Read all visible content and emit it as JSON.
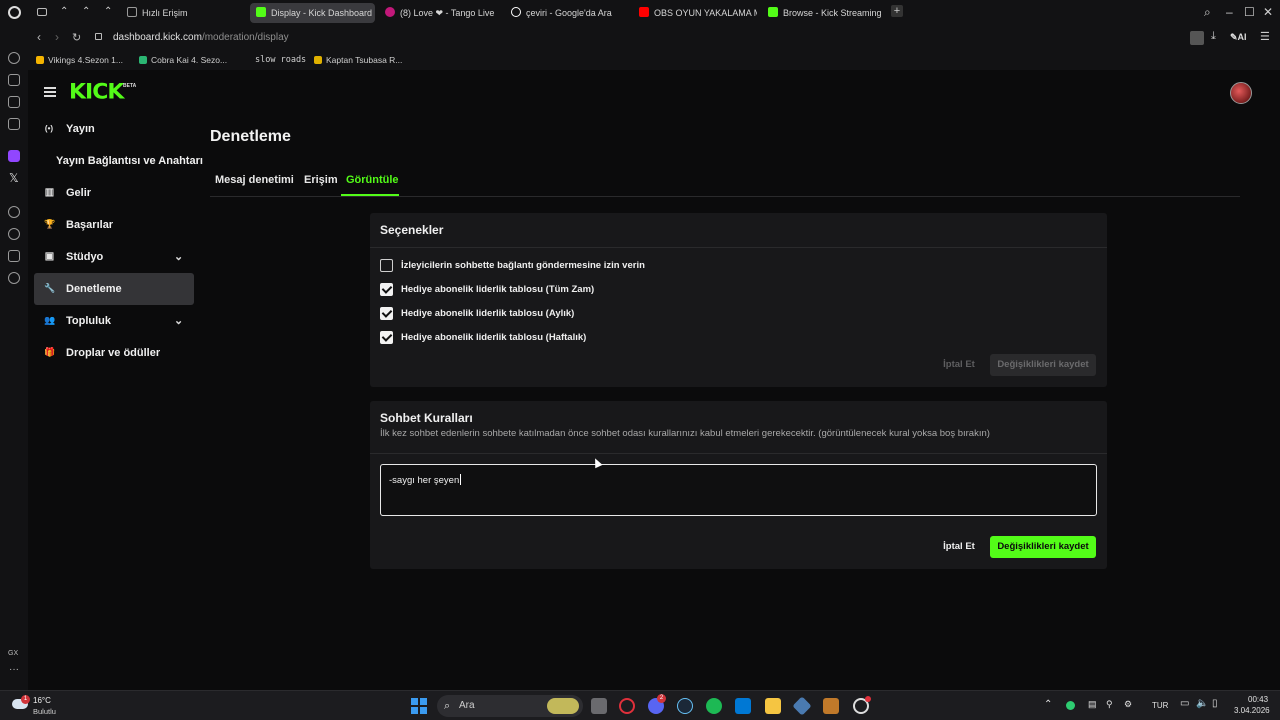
{
  "browser": {
    "tabs": [
      {
        "label": "Hızlı Erişim",
        "icon": "grid-icon",
        "color": "#9a9a9a"
      },
      {
        "label": "Display - Kick Dashboard",
        "icon": "kick-icon",
        "color": "#53fc18",
        "active": true
      },
      {
        "label": "(8) Love ❤ - Tango Live",
        "icon": "tango-icon",
        "color": "#c2187a"
      },
      {
        "label": "çeviri - Google'da Ara",
        "icon": "google-icon",
        "color": "#ffffff"
      },
      {
        "label": "OBS OYUN YAKALAMA M",
        "icon": "youtube-icon",
        "color": "#ff0000"
      },
      {
        "label": "Browse - Kick Streaming",
        "icon": "kick-icon",
        "color": "#53fc18"
      }
    ],
    "url_domain": "dashboard.kick.com",
    "url_path": "/moderation/display",
    "ai_label": "AI",
    "bookmarks": [
      {
        "label": "Vikings 4.Sezon 1...",
        "color": "#f5b400"
      },
      {
        "label": "Cobra Kai 4. Sezo...",
        "color": "#2bb673"
      },
      {
        "label": "slow roads",
        "color": ""
      },
      {
        "label": "Kaptan Tsubasa R...",
        "color": "#e0b100"
      }
    ],
    "gx_label": "GX"
  },
  "kick": {
    "logo": "KICK",
    "logo_badge": "BETA",
    "sidebar": [
      {
        "label": "Yayın",
        "icon": "broadcast-icon",
        "glyph": "(•)",
        "chevron": false,
        "active": false
      },
      {
        "label": "Yayın Bağlantısı ve Anahtarı",
        "icon": "",
        "glyph": "",
        "chevron": false,
        "active": false
      },
      {
        "label": "Gelir",
        "icon": "revenue-icon",
        "glyph": "▥",
        "chevron": false,
        "active": false
      },
      {
        "label": "Başarılar",
        "icon": "trophy-icon",
        "glyph": "🏆",
        "chevron": false,
        "active": false
      },
      {
        "label": "Stüdyo",
        "icon": "studio-icon",
        "glyph": "▣",
        "chevron": true,
        "active": false
      },
      {
        "label": "Denetleme",
        "icon": "wrench-icon",
        "glyph": "🔧",
        "chevron": false,
        "active": true
      },
      {
        "label": "Topluluk",
        "icon": "community-icon",
        "glyph": "👥",
        "chevron": true,
        "active": false
      },
      {
        "label": "Droplar ve ödüller",
        "icon": "gift-icon",
        "glyph": "🎁",
        "chevron": false,
        "active": false
      }
    ],
    "page_title": "Denetleme",
    "tabs": [
      "Mesaj denetimi",
      "Erişim",
      "Görüntüle"
    ],
    "accent": "#53fc18",
    "options_card": {
      "title": "Seçenekler",
      "options": [
        {
          "label": "İzleyicilerin sohbette bağlantı göndermesine izin verin",
          "checked": false
        },
        {
          "label": "Hediye abonelik liderlik tablosu (Tüm Zam)",
          "checked": true
        },
        {
          "label": "Hediye abonelik liderlik tablosu (Aylık)",
          "checked": true
        },
        {
          "label": "Hediye abonelik liderlik tablosu (Haftalık)",
          "checked": true
        }
      ],
      "cancel_label": "İptal Et",
      "save_label": "Değişiklikleri kaydet"
    },
    "rules_card": {
      "title": "Sohbet Kuralları",
      "description": "İlk kez sohbet edenlerin sohbete katılmadan önce sohbet odası kurallarınızı kabul etmeleri gerekecektir. (görüntülenecek kural yoksa boş bırakın)",
      "rules_value": "-saygı her şeyen",
      "cancel_label": "İptal Et",
      "save_label": "Değişiklikleri kaydet"
    }
  },
  "taskbar": {
    "weather_temp": "16°C",
    "weather_desc": "Bulutlu",
    "weather_badge": "1",
    "search_placeholder": "Ara",
    "discord_badge": "2",
    "language": "TUR",
    "time": "00:43",
    "date": "3.04.2026"
  }
}
